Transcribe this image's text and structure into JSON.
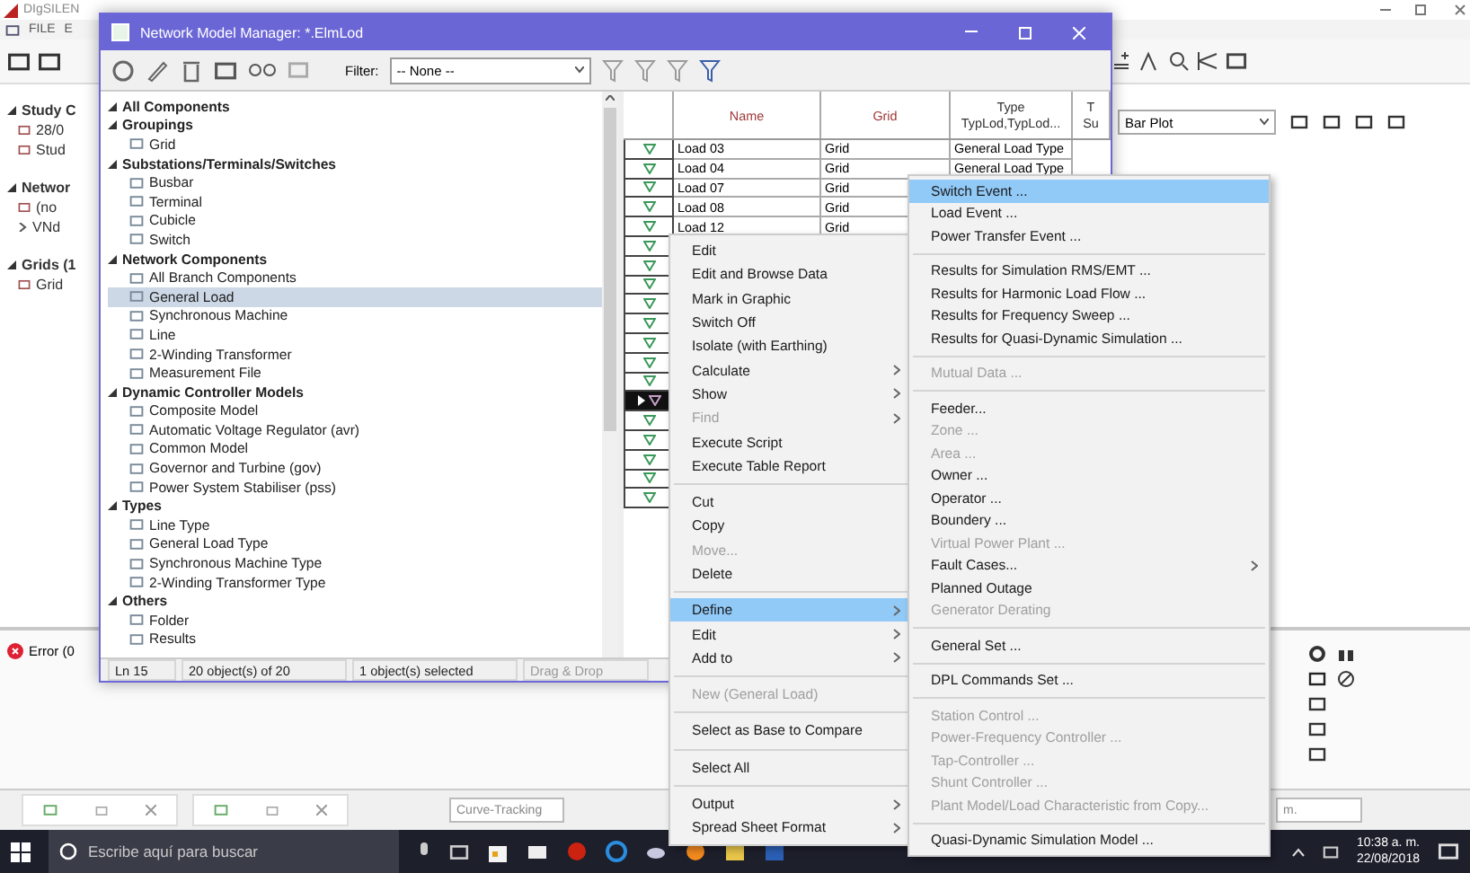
{
  "app": {
    "title": "DIgSILEN",
    "menu": [
      "FILE",
      "E"
    ],
    "tree": [
      {
        "label": "Study C",
        "expanded": true,
        "children": [
          {
            "label": "28/0"
          },
          {
            "label": "Stud"
          }
        ]
      },
      {
        "label": "Networ",
        "expanded": true,
        "children": [
          {
            "label": "(no"
          },
          {
            "label": "VNd",
            "expanded": false
          }
        ]
      },
      {
        "label": "Grids (1",
        "expanded": true,
        "children": [
          {
            "label": "Grid"
          }
        ]
      }
    ],
    "plot_selector": "Bar Plot",
    "error_tab": "Error (0",
    "curve_field": "Curve-Tracking",
    "status_fragment": "m."
  },
  "manager": {
    "title": "Network Model Manager: *.ElmLod",
    "filter_label": "Filter:",
    "filter_value": "-- None --",
    "tree": [
      {
        "label": "All Components",
        "kind": "group",
        "expanded": true,
        "selected": false
      },
      {
        "label": "Groupings",
        "kind": "group",
        "expanded": true,
        "selected": false,
        "children": [
          {
            "label": "Grid",
            "kind": "item",
            "selected": false
          }
        ]
      },
      {
        "label": "Substations/Terminals/Switches",
        "kind": "group",
        "expanded": true,
        "selected": false,
        "children": [
          {
            "label": "Busbar",
            "kind": "item",
            "selected": false
          },
          {
            "label": "Terminal",
            "kind": "item",
            "selected": false
          },
          {
            "label": "Cubicle",
            "kind": "item",
            "selected": false
          },
          {
            "label": "Switch",
            "kind": "item",
            "selected": false
          }
        ]
      },
      {
        "label": "Network Components",
        "kind": "group",
        "expanded": true,
        "selected": false,
        "children": [
          {
            "label": "All Branch Components",
            "kind": "item",
            "selected": false
          },
          {
            "label": "General Load",
            "kind": "item",
            "selected": true
          },
          {
            "label": "Synchronous Machine",
            "kind": "item",
            "selected": false
          },
          {
            "label": "Line",
            "kind": "item",
            "selected": false
          },
          {
            "label": "2-Winding Transformer",
            "kind": "item",
            "selected": false
          },
          {
            "label": "Measurement File",
            "kind": "item",
            "selected": false
          }
        ]
      },
      {
        "label": "Dynamic Controller Models",
        "kind": "group",
        "expanded": true,
        "selected": false,
        "children": [
          {
            "label": "Composite Model",
            "kind": "item",
            "selected": false
          },
          {
            "label": "Automatic Voltage Regulator (avr)",
            "kind": "item",
            "selected": false
          },
          {
            "label": "Common Model",
            "kind": "item",
            "selected": false
          },
          {
            "label": "Governor and Turbine (gov)",
            "kind": "item",
            "selected": false
          },
          {
            "label": "Power System Stabiliser (pss)",
            "kind": "item",
            "selected": false
          }
        ]
      },
      {
        "label": "Types",
        "kind": "group",
        "expanded": true,
        "selected": false,
        "children": [
          {
            "label": "Line Type",
            "kind": "item",
            "selected": false
          },
          {
            "label": "General Load Type",
            "kind": "item",
            "selected": false
          },
          {
            "label": "Synchronous Machine Type",
            "kind": "item",
            "selected": false
          },
          {
            "label": "2-Winding Transformer Type",
            "kind": "item",
            "selected": false
          }
        ]
      },
      {
        "label": "Others",
        "kind": "group",
        "expanded": true,
        "selected": false,
        "children": [
          {
            "label": "Folder",
            "kind": "item",
            "selected": false
          },
          {
            "label": "Results",
            "kind": "item",
            "selected": false
          }
        ]
      }
    ],
    "columns": [
      {
        "label": "Name"
      },
      {
        "label": "Grid"
      },
      {
        "label": "Type",
        "sub": "TypLod,TypLod..."
      },
      {
        "label": "T",
        "sub": "Su"
      }
    ],
    "rows": [
      {
        "name": "Load 03",
        "grid": "Grid",
        "type": "General Load Type",
        "current": false
      },
      {
        "name": "Load 04",
        "grid": "Grid",
        "type": "General Load Type",
        "current": false
      },
      {
        "name": "Load 07",
        "grid": "Grid",
        "current": false
      },
      {
        "name": "Load 08",
        "grid": "Grid",
        "current": false
      },
      {
        "name": "Load 12",
        "grid": "Grid",
        "current": false
      },
      {
        "current": false
      },
      {
        "current": false
      },
      {
        "current": false
      },
      {
        "current": false
      },
      {
        "current": false
      },
      {
        "current": false
      },
      {
        "current": false
      },
      {
        "current": false
      },
      {
        "current": true
      },
      {
        "current": false
      },
      {
        "current": false
      },
      {
        "current": false
      },
      {
        "current": false
      },
      {
        "current": false
      }
    ],
    "status": [
      {
        "text": "Ln 15",
        "disabled": false
      },
      {
        "text": "20 object(s) of 20",
        "disabled": false
      },
      {
        "text": "1 object(s) selected",
        "disabled": false
      },
      {
        "text": "Drag & Drop",
        "disabled": true
      }
    ]
  },
  "context_menu": {
    "items": [
      {
        "kind": "item",
        "label": "Edit",
        "disabled": false,
        "submenu": false,
        "selected": false
      },
      {
        "kind": "item",
        "label": "Edit and Browse Data",
        "disabled": false,
        "submenu": false,
        "selected": false
      },
      {
        "kind": "item",
        "label": "Mark in Graphic",
        "disabled": false,
        "submenu": false,
        "selected": false
      },
      {
        "kind": "item",
        "label": "Switch Off",
        "disabled": false,
        "submenu": false,
        "selected": false
      },
      {
        "kind": "item",
        "label": "Isolate (with Earthing)",
        "disabled": false,
        "submenu": false,
        "selected": false
      },
      {
        "kind": "item",
        "label": "Calculate",
        "disabled": false,
        "submenu": true,
        "selected": false
      },
      {
        "kind": "item",
        "label": "Show",
        "disabled": false,
        "submenu": true,
        "selected": false
      },
      {
        "kind": "item",
        "label": "Find",
        "disabled": true,
        "submenu": true,
        "selected": false
      },
      {
        "kind": "item",
        "label": "Execute Script",
        "disabled": false,
        "submenu": false,
        "selected": false
      },
      {
        "kind": "item",
        "label": "Execute Table Report",
        "disabled": false,
        "submenu": false,
        "selected": false
      },
      {
        "kind": "separator"
      },
      {
        "kind": "item",
        "label": "Cut",
        "disabled": false,
        "submenu": false,
        "selected": false
      },
      {
        "kind": "item",
        "label": "Copy",
        "disabled": false,
        "submenu": false,
        "selected": false
      },
      {
        "kind": "item",
        "label": "Move...",
        "disabled": true,
        "submenu": false,
        "selected": false
      },
      {
        "kind": "item",
        "label": "Delete",
        "disabled": false,
        "submenu": false,
        "selected": false
      },
      {
        "kind": "separator"
      },
      {
        "kind": "item",
        "label": "Define",
        "disabled": false,
        "submenu": true,
        "selected": true
      },
      {
        "kind": "item",
        "label": "Edit",
        "disabled": false,
        "submenu": true,
        "selected": false
      },
      {
        "kind": "item",
        "label": "Add to",
        "disabled": false,
        "submenu": true,
        "selected": false
      },
      {
        "kind": "separator"
      },
      {
        "kind": "item",
        "label": "New (General Load)",
        "disabled": true,
        "submenu": false,
        "selected": false
      },
      {
        "kind": "separator"
      },
      {
        "kind": "item",
        "label": "Select as Base to Compare",
        "disabled": false,
        "submenu": false,
        "selected": false
      },
      {
        "kind": "separator"
      },
      {
        "kind": "item",
        "label": "Select All",
        "disabled": false,
        "submenu": false,
        "selected": false
      },
      {
        "kind": "separator"
      },
      {
        "kind": "item",
        "label": "Output",
        "disabled": false,
        "submenu": true,
        "selected": false
      },
      {
        "kind": "item",
        "label": "Spread Sheet Format",
        "disabled": false,
        "submenu": true,
        "selected": false
      }
    ]
  },
  "submenu": {
    "items": [
      {
        "kind": "item",
        "label": "Switch Event ...",
        "disabled": false,
        "submenu": false,
        "selected": true
      },
      {
        "kind": "item",
        "label": "Load Event ...",
        "disabled": false,
        "submenu": false,
        "selected": false
      },
      {
        "kind": "item",
        "label": "Power Transfer Event ...",
        "disabled": false,
        "submenu": false,
        "selected": false
      },
      {
        "kind": "separator"
      },
      {
        "kind": "item",
        "label": "Results for Simulation RMS/EMT ...",
        "disabled": false,
        "submenu": false,
        "selected": false
      },
      {
        "kind": "item",
        "label": "Results for Harmonic Load Flow ...",
        "disabled": false,
        "submenu": false,
        "selected": false
      },
      {
        "kind": "item",
        "label": "Results for Frequency Sweep ...",
        "disabled": false,
        "submenu": false,
        "selected": false
      },
      {
        "kind": "item",
        "label": "Results for Quasi-Dynamic Simulation ...",
        "disabled": false,
        "submenu": false,
        "selected": false
      },
      {
        "kind": "separator"
      },
      {
        "kind": "item",
        "label": "Mutual Data ...",
        "disabled": true,
        "submenu": false,
        "selected": false
      },
      {
        "kind": "separator"
      },
      {
        "kind": "item",
        "label": "Feeder...",
        "disabled": false,
        "submenu": false,
        "selected": false
      },
      {
        "kind": "item",
        "label": "Zone ...",
        "disabled": true,
        "submenu": false,
        "selected": false
      },
      {
        "kind": "item",
        "label": "Area ...",
        "disabled": true,
        "submenu": false,
        "selected": false
      },
      {
        "kind": "item",
        "label": "Owner ...",
        "disabled": false,
        "submenu": false,
        "selected": false
      },
      {
        "kind": "item",
        "label": "Operator ...",
        "disabled": false,
        "submenu": false,
        "selected": false
      },
      {
        "kind": "item",
        "label": "Boundery ...",
        "disabled": false,
        "submenu": false,
        "selected": false
      },
      {
        "kind": "item",
        "label": "Virtual Power Plant ...",
        "disabled": true,
        "submenu": false,
        "selected": false
      },
      {
        "kind": "item",
        "label": "Fault Cases...",
        "disabled": false,
        "submenu": true,
        "selected": false
      },
      {
        "kind": "item",
        "label": "Planned Outage",
        "disabled": false,
        "submenu": false,
        "selected": false
      },
      {
        "kind": "item",
        "label": "Generator Derating",
        "disabled": true,
        "submenu": false,
        "selected": false
      },
      {
        "kind": "separator"
      },
      {
        "kind": "item",
        "label": "General Set ...",
        "disabled": false,
        "submenu": false,
        "selected": false
      },
      {
        "kind": "separator"
      },
      {
        "kind": "item",
        "label": "DPL Commands Set ...",
        "disabled": false,
        "submenu": false,
        "selected": false
      },
      {
        "kind": "separator"
      },
      {
        "kind": "item",
        "label": "Station Control ...",
        "disabled": true,
        "submenu": false,
        "selected": false
      },
      {
        "kind": "item",
        "label": "Power-Frequency Controller ...",
        "disabled": true,
        "submenu": false,
        "selected": false
      },
      {
        "kind": "item",
        "label": "Tap-Controller ...",
        "disabled": true,
        "submenu": false,
        "selected": false
      },
      {
        "kind": "item",
        "label": "Shunt Controller ...",
        "disabled": true,
        "submenu": false,
        "selected": false
      },
      {
        "kind": "item",
        "label": "Plant Model/Load Characteristic from Copy...",
        "disabled": true,
        "submenu": false,
        "selected": false
      },
      {
        "kind": "separator"
      },
      {
        "kind": "item",
        "label": "Quasi-Dynamic Simulation Model ...",
        "disabled": false,
        "submenu": false,
        "selected": false
      }
    ]
  },
  "taskbar": {
    "search_placeholder": "Escribe aquí para buscar",
    "time": "10:38 a. m.",
    "date": "22/08/2018"
  }
}
